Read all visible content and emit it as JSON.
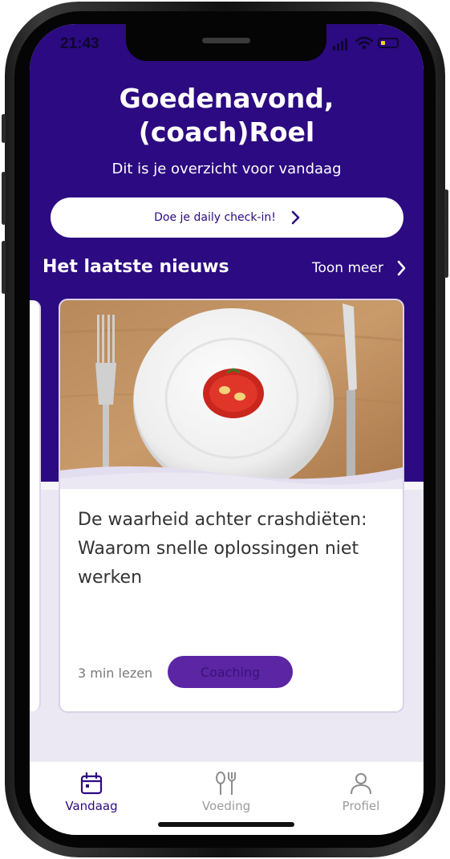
{
  "status_bar": {
    "time": "21:43"
  },
  "header": {
    "greeting_line1": "Goedenavond,",
    "greeting_line2": "(coach)Roel",
    "subtitle": "Dit is je overzicht voor vandaag"
  },
  "checkin_button": {
    "label": "Doe je daily check-in!"
  },
  "news": {
    "title": "Het laatste nieuws",
    "show_more": "Toon meer"
  },
  "article": {
    "title": "De waarheid achter crashdiëten: Waarom snelle oplossingen niet werken",
    "read_time": "3 min lezen",
    "tag": "Coaching"
  },
  "tabs": [
    {
      "label": "Vandaag",
      "icon": "calendar-icon",
      "active": true
    },
    {
      "label": "Voeding",
      "icon": "fork-spoon-icon",
      "active": false
    },
    {
      "label": "Profiel",
      "icon": "person-icon",
      "active": false
    }
  ],
  "colors": {
    "primary": "#2c0a81",
    "tag_bg": "#5b25a4",
    "inactive_tab": "#9b9b9b"
  }
}
